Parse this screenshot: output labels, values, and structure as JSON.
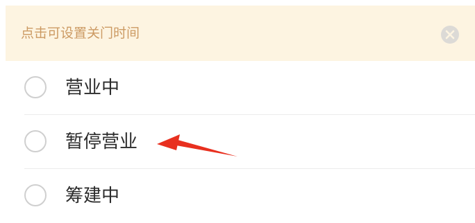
{
  "notice": {
    "text": "点击可设置关门时间",
    "close_icon": "close-circle-icon"
  },
  "status_options": [
    {
      "label": "营业中",
      "selected": false
    },
    {
      "label": "暂停营业",
      "selected": false
    },
    {
      "label": "筹建中",
      "selected": false
    }
  ],
  "annotation": {
    "icon": "red-arrow-icon",
    "color": "#e8301f"
  },
  "colors": {
    "notice_background": "#fdf4e1",
    "notice_text": "#cc9a63",
    "radio_border": "#cfcfcf",
    "label_text": "#2b2b2b"
  }
}
